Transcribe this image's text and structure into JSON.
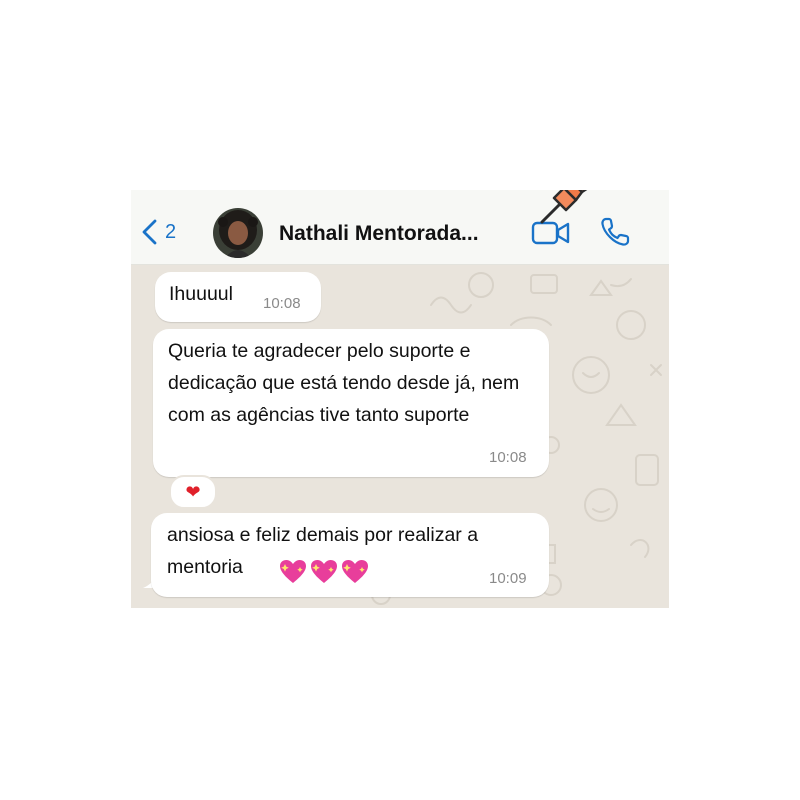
{
  "header": {
    "back_count": "2",
    "contact_name": "Nathali Mentorada...",
    "icons": {
      "back": "chevron-left-icon",
      "video": "video-camera-icon",
      "call": "phone-icon",
      "pin": "pushpin-icon"
    },
    "accent_color": "#1a73c8"
  },
  "messages": [
    {
      "text": "Ihuuuul",
      "time": "10:08"
    },
    {
      "text": "Queria te agradecer pelo suporte e dedicação que está tendo desde já, nem com as agências tive tanto suporte",
      "time": "10:08",
      "reaction": "❤"
    },
    {
      "text": "ansiosa e feliz demais por realizar a mentoria",
      "emojis": [
        "sparkling-heart-icon",
        "sparkling-heart-icon",
        "sparkling-heart-icon"
      ],
      "time": "10:09"
    }
  ]
}
